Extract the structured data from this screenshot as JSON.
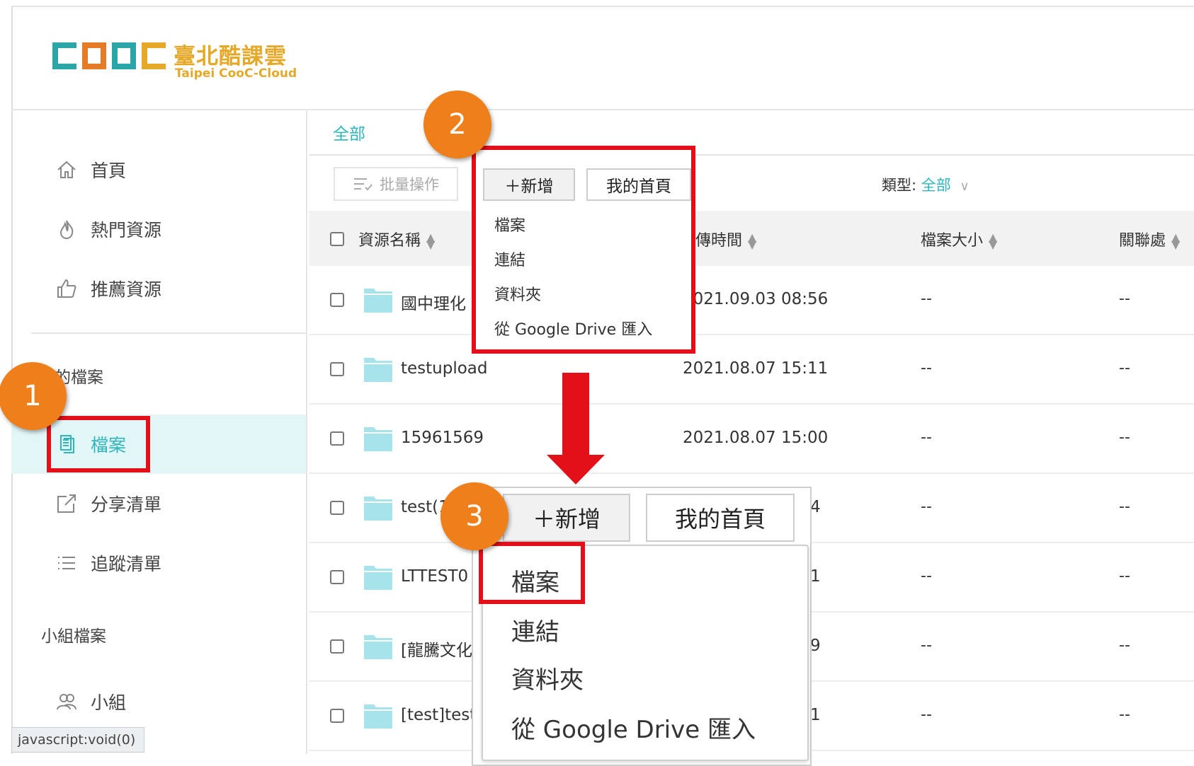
{
  "logo": {
    "cn": "臺北酷課雲",
    "en": "Taipei CooC-Cloud",
    "letters": [
      "C",
      "O",
      "O",
      "C"
    ],
    "colors": [
      "#2aa6a8",
      "#e57a27",
      "#2aa6a8",
      "#e5a92a"
    ]
  },
  "sidebar": {
    "items": [
      {
        "label": "首頁",
        "icon": "home-icon"
      },
      {
        "label": "熱門資源",
        "icon": "fire-icon"
      },
      {
        "label": "推薦資源",
        "icon": "thumbs-up-icon"
      }
    ],
    "my_files_title": "我的檔案",
    "my_files_items": [
      {
        "label": "檔案",
        "icon": "file-icon",
        "active": true
      },
      {
        "label": "分享清單",
        "icon": "share-icon"
      },
      {
        "label": "追蹤清單",
        "icon": "list-icon"
      }
    ],
    "group_title": "小組檔案",
    "group_items": [
      {
        "label": "小組",
        "icon": "group-icon"
      }
    ]
  },
  "breadcrumb": "全部",
  "toolbar": {
    "batch_label": "批量操作",
    "type_label": "類型:",
    "type_value": "全部"
  },
  "table": {
    "headers": {
      "name": "資源名稱",
      "time": "上傳時間",
      "size": "檔案大小",
      "rel": "關聯處"
    },
    "rows": [
      {
        "name": "國中理化",
        "time": "2021.09.03 08:56",
        "size": "--",
        "rel": "--"
      },
      {
        "name": "testupload",
        "time": "2021.08.07 15:11",
        "size": "--",
        "rel": "--"
      },
      {
        "name": "15961569",
        "time": "2021.08.07 15:00",
        "size": "--",
        "rel": "--"
      },
      {
        "name": "test(1",
        "time": "4",
        "size": "--",
        "rel": "--"
      },
      {
        "name": "LTTEST0",
        "time": "1",
        "size": "--",
        "rel": "--"
      },
      {
        "name": "[龍騰文化",
        "time": "9",
        "size": "--",
        "rel": "--"
      },
      {
        "name": "[test]test(",
        "time": "1",
        "size": "--",
        "rel": "--"
      }
    ]
  },
  "popup": {
    "add_label": "＋新增",
    "home_label": "我的首頁",
    "menu": [
      "檔案",
      "連結",
      "資料夾",
      "從 Google Drive 匯入"
    ]
  },
  "badges": [
    "1",
    "2",
    "3"
  ],
  "status_bar": "javascript:void(0)",
  "accent_color": "#2fb6bd",
  "highlight_color": "#e3101a",
  "badge_color": "#ef7f1a"
}
